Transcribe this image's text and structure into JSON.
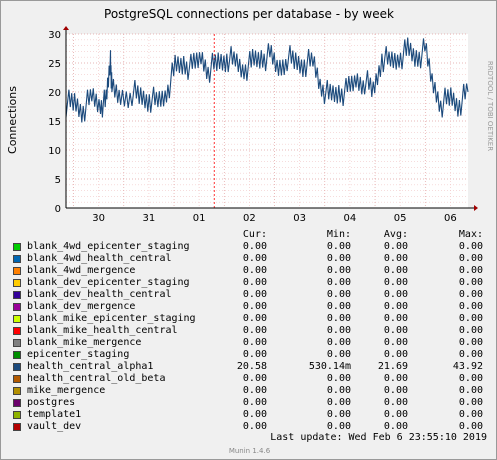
{
  "chart_data": {
    "type": "line",
    "title": "PostgreSQL connections per database - by week",
    "ylabel": "Connections",
    "xlabel": "",
    "side_label": "RRDTOOL / TOBI OETIKER",
    "x_ticks": [
      "30",
      "31",
      "01",
      "02",
      "03",
      "04",
      "05",
      "06"
    ],
    "ylim": [
      0,
      30
    ],
    "y_ticks": [
      0,
      5,
      10,
      15,
      20,
      25,
      30
    ],
    "grid": true,
    "series": [
      {
        "name": "health_central_alpha1",
        "color": "#1c4a7c",
        "x_days": [
          0.0,
          0.3,
          0.6,
          0.9,
          1.2,
          1.4,
          1.55,
          1.6,
          1.9,
          2.3,
          2.6,
          2.9,
          3.2,
          3.5,
          3.8,
          4.1,
          4.4,
          4.7,
          5.0,
          5.3,
          5.6,
          5.9,
          6.2,
          6.5,
          6.8,
          7.1,
          7.4,
          7.7,
          8.0,
          8.3,
          8.6,
          8.9,
          9.2,
          9.5,
          9.8,
          10.1,
          10.4,
          10.7,
          11.0,
          11.3,
          11.6,
          11.9,
          12.2,
          12.5,
          12.8,
          13.1,
          13.4,
          13.7,
          14.0
        ],
        "values": [
          18,
          18,
          17,
          19,
          18,
          18,
          26,
          20,
          19,
          20,
          19,
          19,
          18,
          20,
          24,
          25,
          24,
          26,
          24,
          25,
          26,
          25,
          24,
          25,
          26,
          26,
          24,
          26,
          25,
          25,
          25,
          21,
          19,
          20,
          20,
          22,
          22,
          20,
          26,
          25,
          26,
          27,
          26,
          27,
          21,
          18,
          19,
          18,
          20
        ]
      }
    ]
  },
  "legend": {
    "headers": {
      "cur": "Cur:",
      "min": "Min:",
      "avg": "Avg:",
      "max": "Max:"
    },
    "rows": [
      {
        "name": "blank_4wd_epicenter_staging",
        "color": "#00cc00",
        "cur": "0.00",
        "min": "0.00",
        "avg": "0.00",
        "max": "0.00"
      },
      {
        "name": "blank_4wd_health_central",
        "color": "#0066b3",
        "cur": "0.00",
        "min": "0.00",
        "avg": "0.00",
        "max": "0.00"
      },
      {
        "name": "blank_4wd_mergence",
        "color": "#ff8000",
        "cur": "0.00",
        "min": "0.00",
        "avg": "0.00",
        "max": "0.00"
      },
      {
        "name": "blank_dev_epicenter_staging",
        "color": "#ffcc00",
        "cur": "0.00",
        "min": "0.00",
        "avg": "0.00",
        "max": "0.00"
      },
      {
        "name": "blank_dev_health_central",
        "color": "#330099",
        "cur": "0.00",
        "min": "0.00",
        "avg": "0.00",
        "max": "0.00"
      },
      {
        "name": "blank_dev_mergence",
        "color": "#990099",
        "cur": "0.00",
        "min": "0.00",
        "avg": "0.00",
        "max": "0.00"
      },
      {
        "name": "blank_mike_epicenter_staging",
        "color": "#ccff00",
        "cur": "0.00",
        "min": "0.00",
        "avg": "0.00",
        "max": "0.00"
      },
      {
        "name": "blank_mike_health_central",
        "color": "#ff0000",
        "cur": "0.00",
        "min": "0.00",
        "avg": "0.00",
        "max": "0.00"
      },
      {
        "name": "blank_mike_mergence",
        "color": "#808080",
        "cur": "0.00",
        "min": "0.00",
        "avg": "0.00",
        "max": "0.00"
      },
      {
        "name": "epicenter_staging",
        "color": "#008f00",
        "cur": "0.00",
        "min": "0.00",
        "avg": "0.00",
        "max": "0.00"
      },
      {
        "name": "health_central_alpha1",
        "color": "#1c4a7c",
        "cur": "20.58",
        "min": "530.14m",
        "avg": "21.69",
        "max": "43.92"
      },
      {
        "name": "health_central_old_beta",
        "color": "#b35a00",
        "cur": "0.00",
        "min": "0.00",
        "avg": "0.00",
        "max": "0.00"
      },
      {
        "name": "mike_mergence",
        "color": "#b38f00",
        "cur": "0.00",
        "min": "0.00",
        "avg": "0.00",
        "max": "0.00"
      },
      {
        "name": "postgres",
        "color": "#6b006b",
        "cur": "0.00",
        "min": "0.00",
        "avg": "0.00",
        "max": "0.00"
      },
      {
        "name": "template1",
        "color": "#8fb300",
        "cur": "0.00",
        "min": "0.00",
        "avg": "0.00",
        "max": "0.00"
      },
      {
        "name": "vault_dev",
        "color": "#b30000",
        "cur": "0.00",
        "min": "0.00",
        "avg": "0.00",
        "max": "0.00"
      }
    ]
  },
  "footer": {
    "last_update": "Last update:  Wed Feb  6 23:55:10 2019",
    "version": "Munin 1.4.6"
  }
}
